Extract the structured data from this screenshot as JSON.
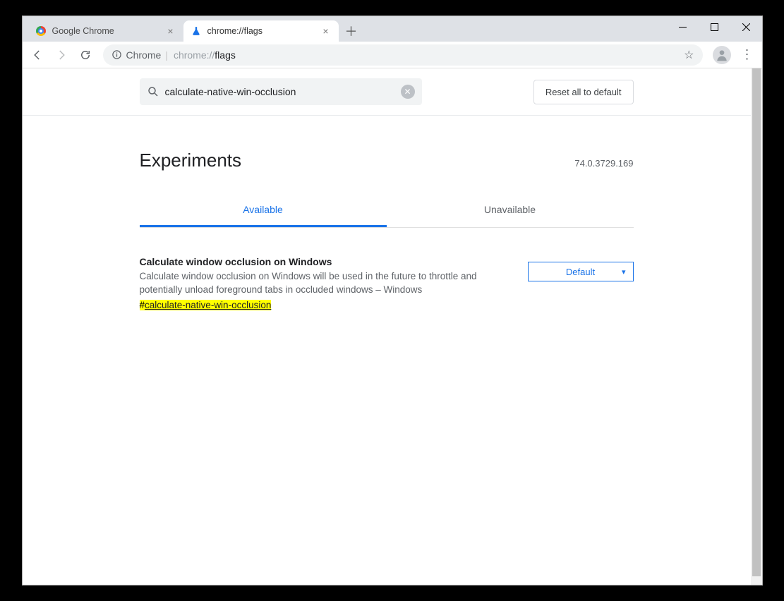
{
  "tabs": [
    {
      "label": "Google Chrome"
    },
    {
      "label": "chrome://flags"
    }
  ],
  "omnibox": {
    "prefix": "Chrome",
    "url_dim": "chrome://",
    "url_bold": "flags"
  },
  "search": {
    "value": "calculate-native-win-occlusion"
  },
  "reset_label": "Reset all to default",
  "page_title": "Experiments",
  "version": "74.0.3729.169",
  "page_tabs": {
    "available": "Available",
    "unavailable": "Unavailable"
  },
  "flag": {
    "title": "Calculate window occlusion on Windows",
    "desc": "Calculate window occlusion on Windows will be used in the future to throttle and potentially unload foreground tabs in occluded windows – Windows",
    "hash": "#",
    "anchor": "calculate-native-win-occlusion",
    "select_value": "Default"
  }
}
